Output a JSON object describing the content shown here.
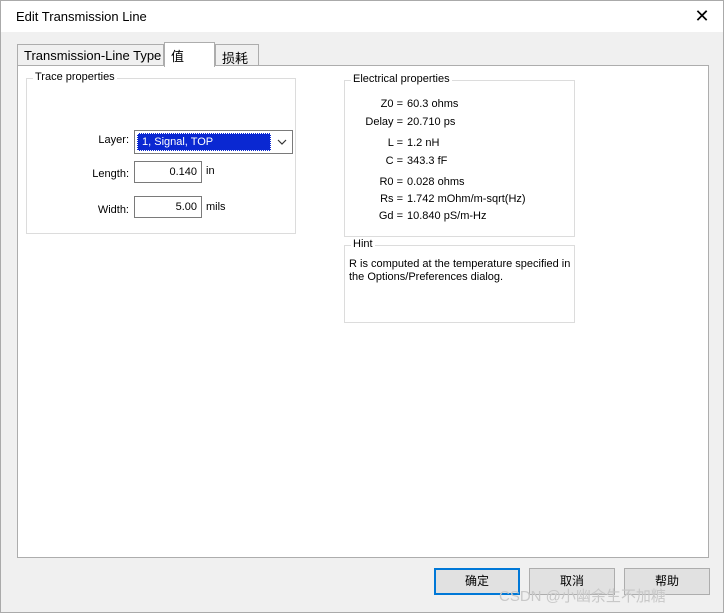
{
  "window": {
    "title": "Edit Transmission Line",
    "close": "✕"
  },
  "tabs": [
    {
      "label": "Transmission-Line Type"
    },
    {
      "label": "值"
    },
    {
      "label": "损耗"
    }
  ],
  "trace": {
    "title": "Trace properties",
    "layer_label": "Layer:",
    "layer_value": "1, Signal, TOP",
    "length_label": "Length:",
    "length_value": "0.140",
    "length_unit": "in",
    "width_label": "Width:",
    "width_value": "5.00",
    "width_unit": "mils"
  },
  "electrical": {
    "title": "Electrical properties",
    "rows": [
      {
        "name": "Z0 =",
        "value": "60.3 ohms"
      },
      {
        "name": "Delay =",
        "value": "20.710 ps"
      },
      {
        "name": "L =",
        "value": "1.2 nH"
      },
      {
        "name": "C =",
        "value": "343.3 fF"
      },
      {
        "name": "R0 =",
        "value": "0.028 ohms"
      },
      {
        "name": "Rs =",
        "value": "1.742 mOhm/m-sqrt(Hz)"
      },
      {
        "name": "Gd =",
        "value": "10.840 pS/m-Hz"
      }
    ]
  },
  "hint": {
    "title": "Hint",
    "text": "R is computed at the temperature specified in the Options/Preferences dialog."
  },
  "buttons": {
    "ok": "确定",
    "cancel": "取消",
    "help": "帮助"
  },
  "watermark": "CSDN @小幽余生不加糖",
  "colors": {
    "accent": "#0078d7",
    "selection": "#0a28d2"
  }
}
